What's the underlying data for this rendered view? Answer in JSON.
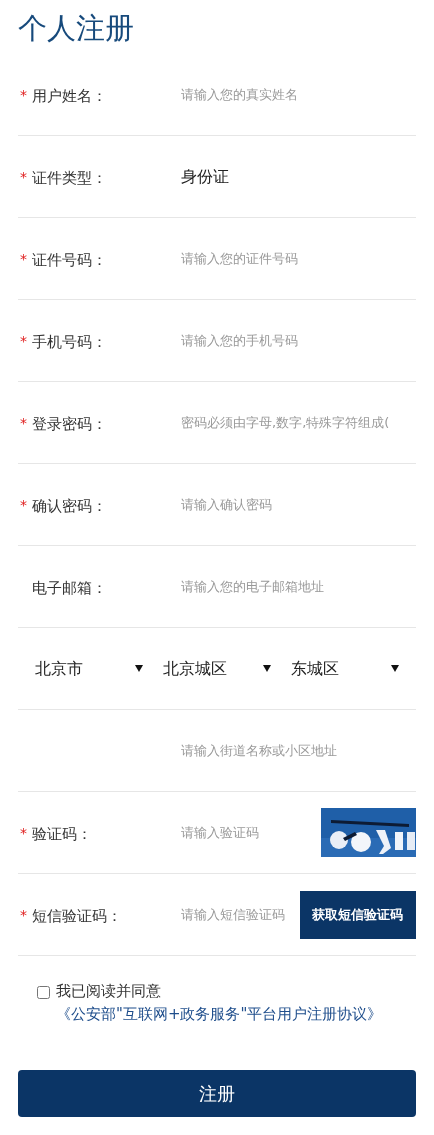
{
  "title": "个人注册",
  "fields": [
    {
      "kind": "input",
      "required_mark": "*",
      "label": "用户姓名：",
      "placeholder": "请输入您的真实姓名"
    },
    {
      "kind": "select",
      "required_mark": "*",
      "label": "证件类型：",
      "value": "身份证"
    },
    {
      "kind": "input",
      "required_mark": "*",
      "label": "证件号码：",
      "placeholder": "请输入您的证件号码"
    },
    {
      "kind": "input",
      "required_mark": "*",
      "label": "手机号码：",
      "placeholder": "请输入您的手机号码"
    },
    {
      "kind": "input",
      "required_mark": "*",
      "label": "登录密码：",
      "placeholder": "密码必须由字母,数字,特殊字符组成("
    },
    {
      "kind": "input",
      "required_mark": "*",
      "label": "确认密码：",
      "placeholder": "请输入确认密码"
    },
    {
      "kind": "input",
      "label": "电子邮箱：",
      "placeholder": "请输入您的电子邮箱地址"
    },
    {
      "kind": "region",
      "selects": [
        "北京市",
        "北京城区",
        "东城区"
      ]
    },
    {
      "kind": "input",
      "placeholder": "请输入街道名称或小区地址"
    },
    {
      "kind": "captcha",
      "required_mark": "*",
      "label": "验证码：",
      "placeholder": "请输入验证码"
    },
    {
      "kind": "sms",
      "required_mark": "*",
      "label": "短信验证码：",
      "placeholder": "请输入短信验证码",
      "button": "获取短信验证码"
    }
  ],
  "agreement": {
    "checked": false,
    "text": "我已阅读并同意",
    "link": "《公安部\"互联网+政务服务\"平台用户注册协议》"
  },
  "submit": "注册"
}
